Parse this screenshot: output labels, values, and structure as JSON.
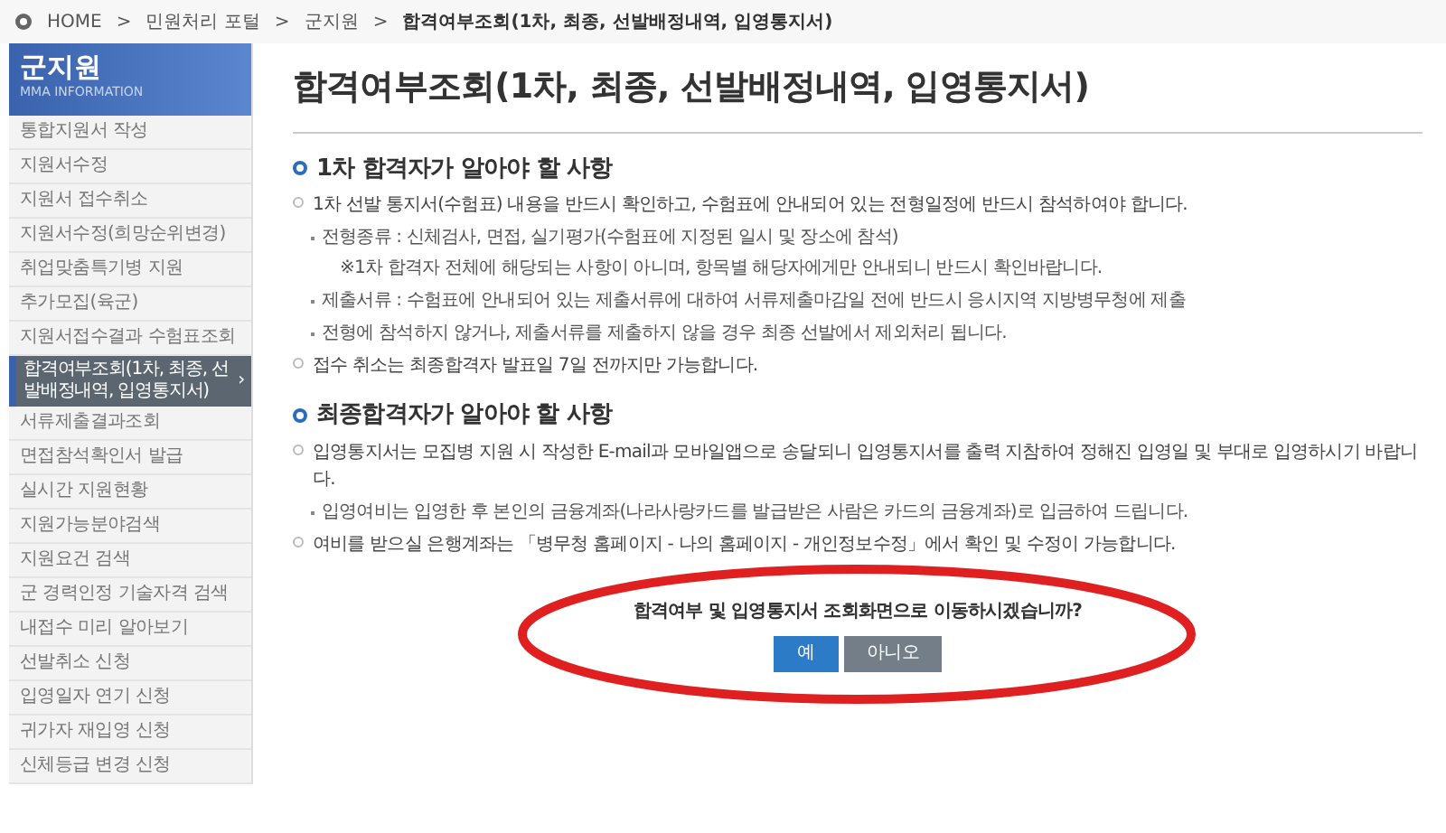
{
  "breadcrumb": [
    "HOME",
    "민원처리 포털",
    "군지원",
    "합격여부조회(1차, 최종, 선발배정내역, 입영통지서)"
  ],
  "breadcrumb_separator": ">",
  "sidebar": {
    "title": "군지원",
    "selected_marker": "›",
    "subtitle": "MMA INFORMATION",
    "items": [
      {
        "label": "통합지원서 작성",
        "selected": false
      },
      {
        "label": "지원서수정",
        "selected": false
      },
      {
        "label": "지원서 접수취소",
        "selected": false
      },
      {
        "label": "지원서수정(희망순위변경)",
        "selected": false
      },
      {
        "label": "취업맞춤특기병 지원",
        "selected": false
      },
      {
        "label": "추가모집(육군)",
        "selected": false
      },
      {
        "label": "지원서접수결과 수험표조회",
        "selected": false
      },
      {
        "label": "합격여부조회(1차, 최종, 선발배정내역, 입영통지서)",
        "selected": true
      },
      {
        "label": "서류제출결과조회",
        "selected": false
      },
      {
        "label": "면접참석확인서 발급",
        "selected": false
      },
      {
        "label": "실시간 지원현황",
        "selected": false
      },
      {
        "label": "지원가능분야검색",
        "selected": false
      },
      {
        "label": "지원요건 검색",
        "selected": false
      },
      {
        "label": "군 경력인정 기술자격 검색",
        "selected": false
      },
      {
        "label": "내접수 미리 알아보기",
        "selected": false
      },
      {
        "label": "선발취소 신청",
        "selected": false
      },
      {
        "label": "입영일자 연기 신청",
        "selected": false
      },
      {
        "label": "귀가자 재입영 신청",
        "selected": false
      },
      {
        "label": "신체등급 변경 신청",
        "selected": false
      }
    ]
  },
  "page_title": "합격여부조회(1차, 최종, 선발배정내역, 입영통지서)",
  "sections": [
    {
      "heading": "1차 합격자가 알아야 할 사항",
      "lines": [
        {
          "kind": "item",
          "text": "1차 선발 통지서(수험표) 내용을 반드시 확인하고, 수험표에 안내되어 있는 전형일정에 반드시 참석하여야 합니다."
        },
        {
          "kind": "sub",
          "text": "전형종류 : 신체검사, 면접, 실기평가(수험표에 지정된 일시 및 장소에 참석)"
        },
        {
          "kind": "note",
          "text": "※1차 합격자 전체에 해당되는 사항이 아니며, 항목별 해당자에게만 안내되니 반드시 확인바랍니다."
        },
        {
          "kind": "sub",
          "text": "제출서류 : 수험표에 안내되어 있는 제출서류에 대하여 서류제출마감일 전에 반드시 응시지역 지방병무청에 제출"
        },
        {
          "kind": "sub",
          "text": "전형에 참석하지 않거나, 제출서류를 제출하지 않을 경우 최종 선발에서 제외처리 됩니다."
        },
        {
          "kind": "item",
          "text": "접수 취소는 최종합격자 발표일 7일 전까지만 가능합니다."
        }
      ]
    },
    {
      "heading": "최종합격자가 알아야 할 사항",
      "lines": [
        {
          "kind": "item",
          "text": "입영통지서는 모집병 지원 시 작성한 E-mail과 모바일앱으로 송달되니 입영통지서를 출력 지참하여 정해진 입영일 및 부대로 입영하시기 바랍니다."
        },
        {
          "kind": "sub",
          "text": "입영여비는 입영한 후 본인의 금융계좌(나라사랑카드를 발급받은 사람은 카드의 금융계좌)로 입금하여 드립니다."
        },
        {
          "kind": "item",
          "text": "여비를 받으실 은행계좌는 「병무청 홈페이지 - 나의 홈페이지 - 개인정보수정」에서 확인 및 수정이 가능합니다."
        }
      ]
    }
  ],
  "dialog": {
    "message": "합격여부 및 입영통지서 조회화면으로 이동하시겠습니까?",
    "buttons": [
      {
        "label": "예",
        "kind": "primary"
      },
      {
        "label": "아니오",
        "kind": "secondary"
      }
    ]
  }
}
